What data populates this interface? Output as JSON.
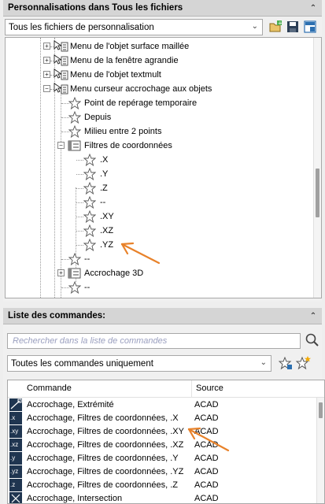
{
  "customizations_panel": {
    "title": "Personnalisations dans Tous les fichiers",
    "file_filter": "Tous les fichiers de personnalisation",
    "tree": [
      {
        "label": "Menu de l'objet surface maillée",
        "icon": "context-menu-icon",
        "expander": "+"
      },
      {
        "label": "Menu de la fenêtre agrandie",
        "icon": "context-menu-icon",
        "expander": "+"
      },
      {
        "label": "Menu de l'objet textmult",
        "icon": "context-menu-icon",
        "expander": "+"
      },
      {
        "label": "Menu curseur accrochage aux objets",
        "icon": "context-menu-icon",
        "expander": "-"
      },
      {
        "label": "Point de repérage temporaire",
        "icon": "star-icon"
      },
      {
        "label": "Depuis",
        "icon": "star-icon"
      },
      {
        "label": "Milieu entre 2 points",
        "icon": "star-icon"
      },
      {
        "label": "Filtres de coordonnées",
        "icon": "submenu-icon",
        "expander": "-"
      },
      {
        "label": ".X",
        "icon": "star-icon"
      },
      {
        "label": ".Y",
        "icon": "star-icon"
      },
      {
        "label": ".Z",
        "icon": "star-icon"
      },
      {
        "label": "--",
        "icon": "star-icon"
      },
      {
        "label": ".XY",
        "icon": "star-icon"
      },
      {
        "label": ".XZ",
        "icon": "star-icon"
      },
      {
        "label": ".YZ",
        "icon": "star-icon"
      },
      {
        "label": "--",
        "icon": "star-icon"
      },
      {
        "label": "Accrochage 3D",
        "icon": "submenu-icon",
        "expander": "+"
      },
      {
        "label": "--",
        "icon": "star-icon"
      }
    ]
  },
  "commands_panel": {
    "title": "Liste des commandes:",
    "search_placeholder": "Rechercher dans la liste de commandes",
    "filter": "Toutes les commandes uniquement",
    "columns": [
      "Commande",
      "Source"
    ],
    "rows": [
      {
        "name": "Accrochage, Extrémité",
        "source": "ACAD",
        "icon": ""
      },
      {
        "name": "Accrochage, Filtres de coordonnées, .X",
        "source": "ACAD",
        "icon": ".x"
      },
      {
        "name": "Accrochage, Filtres de coordonnées, .XY",
        "source": "ACAD",
        "icon": ".xy"
      },
      {
        "name": "Accrochage, Filtres de coordonnées, .XZ",
        "source": "ACAD",
        "icon": ".xz"
      },
      {
        "name": "Accrochage, Filtres de coordonnées, .Y",
        "source": "ACAD",
        "icon": ".y"
      },
      {
        "name": "Accrochage, Filtres de coordonnées, .YZ",
        "source": "ACAD",
        "icon": ".yz"
      },
      {
        "name": "Accrochage, Filtres de coordonnées, .Z",
        "source": "ACAD",
        "icon": ".z"
      },
      {
        "name": "Accrochage, Intersection",
        "source": "ACAD",
        "icon": ""
      }
    ]
  },
  "colors": {
    "annotation_arrow": "#e8822a",
    "header_bg": "#d5d5d5",
    "icon_bg": "#1f3550"
  }
}
